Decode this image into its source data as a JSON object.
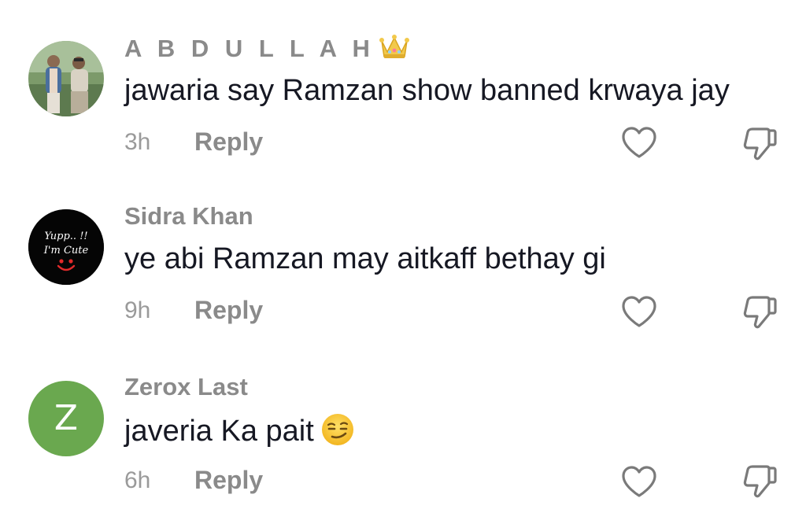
{
  "comments": [
    {
      "username": "A B D U L L A H",
      "text": "jawaria say Ramzan show banned krwaya jay",
      "time": "3h",
      "reply_label": "Reply",
      "avatar_icon": "photo-avatar-icon",
      "badge_icon": "crown-icon"
    },
    {
      "username": "Sidra Khan",
      "text": "ye abi Ramzan may aitkaff bethay gi",
      "time": "9h",
      "reply_label": "Reply",
      "avatar_icon": "yupp-im-cute-avatar-icon",
      "avatar_text_line1": "Yupp.. !!",
      "avatar_text_line2": "I'm Cute"
    },
    {
      "username": "Zerox Last",
      "text": "javeria Ka pait",
      "time": "6h",
      "reply_label": "Reply",
      "avatar_icon": "letter-avatar-icon",
      "avatar_letter": "Z",
      "avatar_color": "#6aa84f",
      "text_emoji": "smirk-emoji-icon"
    }
  ],
  "colors": {
    "username": "#8a8a8a",
    "text": "#161823",
    "meta": "#9a9a9a",
    "icon": "#7a7a7a"
  }
}
